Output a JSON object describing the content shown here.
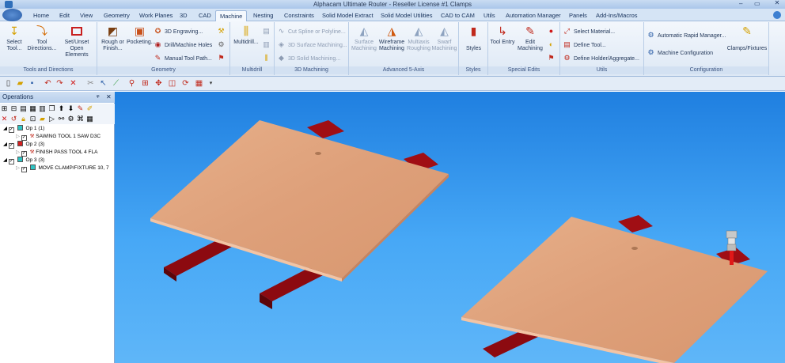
{
  "window": {
    "title": "Alphacam Ultimate Router - Reseller License #1 Clamps"
  },
  "menu": {
    "tabs": [
      {
        "label": "Home",
        "active": false
      },
      {
        "label": "Edit",
        "active": false
      },
      {
        "label": "View",
        "active": false
      },
      {
        "label": "Geometry",
        "active": false
      },
      {
        "label": "Work Planes",
        "active": false
      },
      {
        "label": "3D",
        "active": false
      },
      {
        "label": "CAD",
        "active": false
      },
      {
        "label": "Machine",
        "active": true
      },
      {
        "label": "Nesting",
        "active": false
      },
      {
        "label": "Constraints",
        "active": false
      },
      {
        "label": "Solid Model Extract",
        "active": false
      },
      {
        "label": "Solid Model Utilities",
        "active": false
      },
      {
        "label": "CAD to CAM",
        "active": false
      },
      {
        "label": "Utils",
        "active": false
      },
      {
        "label": "Automation Manager",
        "active": false
      },
      {
        "label": "Panels",
        "active": false
      },
      {
        "label": "Add-Ins/Macros",
        "active": false
      }
    ]
  },
  "ribbon": {
    "tools_and_directions": {
      "title": "Tools and Directions",
      "select_tool": "Select Tool...",
      "tool_directions": "Tool Directions...",
      "set_unset": "Set/Unset Open Elements"
    },
    "geometry": {
      "title": "Geometry",
      "rough_or_finish": "Rough or Finish...",
      "pocketing": "Pocketing...",
      "engraving": "3D Engraving...",
      "drill": "Drill/Machine Holes",
      "manual": "Manual Tool Path..."
    },
    "multidrill": {
      "title": "Multidrill",
      "label": "Multidrill..."
    },
    "machining3d": {
      "title": "3D Machining",
      "cut_spline": "Cut Spline or Polyline...",
      "surface": "3D Surface Machining...",
      "solid": "3D Solid Machining..."
    },
    "advanced5": {
      "title": "Advanced 5-Axis",
      "surface": "Surface Machining",
      "wireframe": "Wireframe Machining",
      "multiaxis": "Multiaxis Roughing",
      "swarf": "Swarf Machining"
    },
    "styles": {
      "title": "Styles",
      "label": "Styles"
    },
    "special": {
      "title": "Special Edits",
      "tool_entry": "Tool Entry",
      "edit_machining": "Edit Machining"
    },
    "utils": {
      "title": "Utils",
      "select_material": "Select Material...",
      "define_tool": "Define Tool...",
      "define_holder": "Define Holder/Aggregate..."
    },
    "configuration": {
      "title": "Configuration",
      "auto_rapid": "Automatic Rapid Manager...",
      "machine_config": "Machine Configuration",
      "clamps": "Clamps/Fixtures"
    }
  },
  "operations": {
    "title": "Operations",
    "items": [
      {
        "label": "Op 1   (1)",
        "color": "#2ec4c4"
      },
      {
        "label": "SAWING   TOOL 1   SAW D3C",
        "child": true
      },
      {
        "label": "Op 2   (3)",
        "color": "#d42020"
      },
      {
        "label": "FINISH PASS   TOOL 4   FLA",
        "child": true
      },
      {
        "label": "Op 3   (3)",
        "color": "#2ec4c4"
      },
      {
        "label": "MOVE CLAMP/FIXTURE 10, 7",
        "child": true
      }
    ]
  },
  "colors": {
    "accent": "#1e7fdf",
    "board": "#e0a27a",
    "clamp": "#8c0a10"
  }
}
